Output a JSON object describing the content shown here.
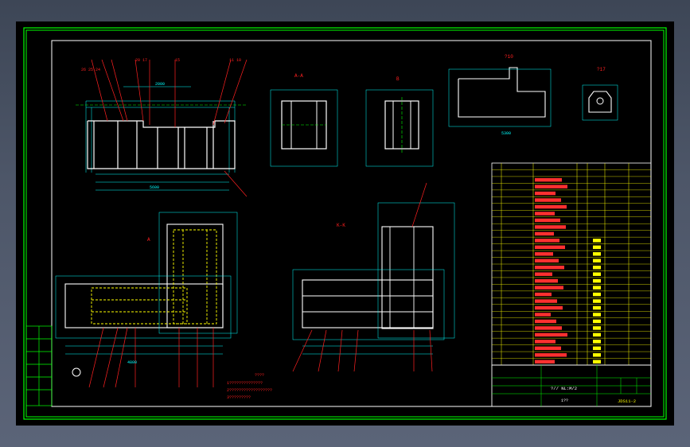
{
  "drawing": {
    "section_aa": "A-A",
    "section_bb": "B-B",
    "section_kk": "K-K",
    "view_a_label": "A",
    "view_b_label": "B",
    "detail_label_1": "?10",
    "detail_label_2": "?17",
    "dim_overall": "2000",
    "dim_5600": "5600",
    "dim_4800": "4800"
  },
  "title_block": {
    "drawing_title": "?// NL:M/2",
    "drawing_number": "JDS11-2",
    "sub_text": "1??",
    "scale_cells": [
      "?",
      "?",
      "?"
    ]
  },
  "notes": {
    "line1": "????",
    "line2": "1??????????????",
    "line3": "2??????????????????",
    "line4": "3?????????"
  },
  "colors": {
    "frame_green": "#00ff00",
    "dim_cyan": "#00ffff",
    "part_white": "#ffffff",
    "leader_red": "#ff2020",
    "table_yellow": "#ffff00",
    "magenta": "#ff00ff"
  }
}
